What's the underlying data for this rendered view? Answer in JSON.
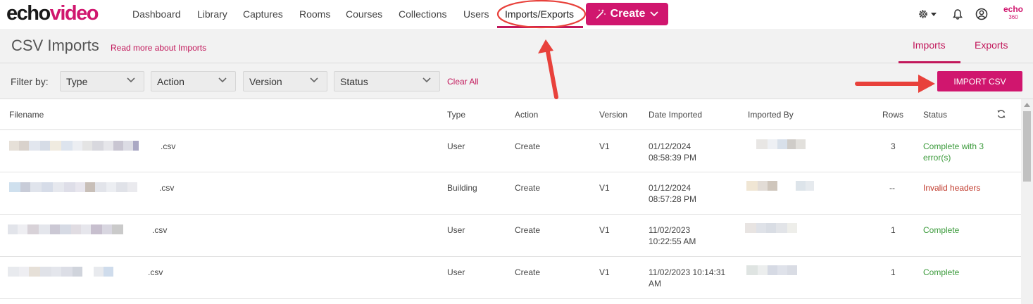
{
  "app": {
    "logo_part1": "echo",
    "logo_part2": "video",
    "brand_small_top": "echo",
    "brand_small_bottom": "360"
  },
  "nav": {
    "items": [
      "Dashboard",
      "Library",
      "Captures",
      "Rooms",
      "Courses",
      "Collections",
      "Users",
      "Imports/Exports"
    ],
    "active": "Imports/Exports",
    "create_label": "Create"
  },
  "page": {
    "title": "CSV Imports",
    "read_more": "Read more about Imports",
    "tabs": [
      "Imports",
      "Exports"
    ],
    "active_tab": "Imports"
  },
  "filters": {
    "label": "Filter by:",
    "selects": [
      "Type",
      "Action",
      "Version",
      "Status"
    ],
    "clear_all": "Clear All",
    "import_button": "IMPORT CSV"
  },
  "table": {
    "headers": [
      "Filename",
      "Type",
      "Action",
      "Version",
      "Date Imported",
      "Imported By",
      "Rows",
      "Status"
    ],
    "rows": [
      {
        "file_ext": ".csv",
        "type": "User",
        "action": "Create",
        "version": "V1",
        "date_line1": "01/12/2024",
        "date_line2": "08:58:39 PM",
        "rows": "3",
        "status_line1": "Complete with 3",
        "status_line2": "error(s)",
        "status_kind": "ok"
      },
      {
        "file_ext": ".csv",
        "type": "Building",
        "action": "Create",
        "version": "V1",
        "date_line1": "01/12/2024",
        "date_line2": "08:57:28 PM",
        "rows": "--",
        "status_line1": "Invalid headers",
        "status_line2": "",
        "status_kind": "err"
      },
      {
        "file_ext": ".csv",
        "type": "User",
        "action": "Create",
        "version": "V1",
        "date_line1": "11/02/2023",
        "date_line2": "10:22:55 AM",
        "rows": "1",
        "status_line1": "Complete",
        "status_line2": "",
        "status_kind": "ok"
      },
      {
        "file_ext": ".csv",
        "type": "User",
        "action": "Create",
        "version": "V1",
        "date_line1": "11/02/2023 10:14:31",
        "date_line2": "AM",
        "rows": "1",
        "status_line1": "Complete",
        "status_line2": "",
        "status_kind": "ok"
      }
    ]
  },
  "colors": {
    "brand": "#d0166e",
    "status_ok": "#3a9a3a",
    "status_err": "#c0392b",
    "annotation": "#e8413b"
  },
  "icons": {
    "create": "magic-wand-icon",
    "settings": "gear-icon",
    "notifications": "bell-icon",
    "account": "user-circle-icon",
    "refresh": "refresh-icon",
    "dropdown": "chevron-down-icon"
  }
}
